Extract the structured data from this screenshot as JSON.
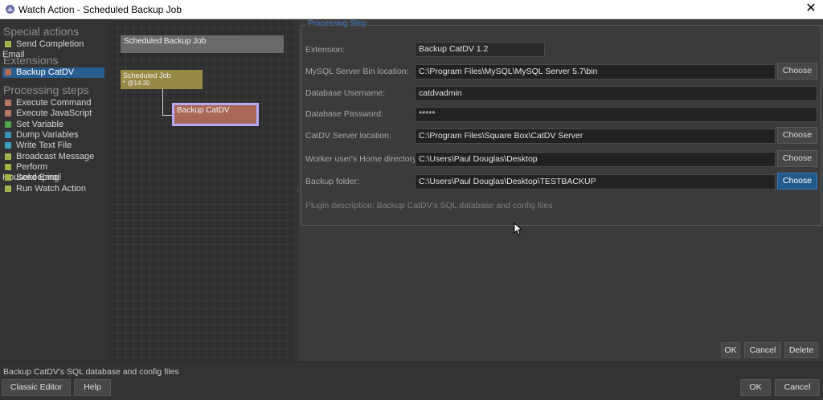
{
  "window": {
    "title": "Watch Action - Scheduled Backup Job",
    "close_glyph": "✕"
  },
  "sidebar": {
    "special_actions": {
      "heading": "Special actions",
      "items": [
        {
          "label": "Send Completion Email",
          "color": "#a6b14a"
        }
      ]
    },
    "extensions": {
      "heading": "Extensions",
      "items": [
        {
          "label": "Backup CatDV",
          "color": "#b06a55",
          "selected": true
        }
      ]
    },
    "processing_steps": {
      "heading": "Processing steps",
      "items": [
        {
          "label": "Execute Command",
          "color": "#b07a5c"
        },
        {
          "label": "Execute JavaScript",
          "color": "#b07a5c"
        },
        {
          "label": "Set Variable",
          "color": "#4fa44b"
        },
        {
          "label": "Dump Variables",
          "color": "#3f8fb6"
        },
        {
          "label": "Write Text File",
          "color": "#3fa0b8"
        },
        {
          "label": "Broadcast Message",
          "color": "#a6b14a"
        },
        {
          "label": "Perform Housekeeping",
          "color": "#a6b14a"
        },
        {
          "label": "Send Email",
          "color": "#a6b14a"
        },
        {
          "label": "Run Watch Action",
          "color": "#a6b14a"
        }
      ]
    }
  },
  "canvas": {
    "job_node": {
      "label": "Scheduled Backup Job"
    },
    "schedule_node": {
      "label": "Scheduled Job",
      "sub": "* @14:30"
    },
    "backup_node": {
      "label": "Backup CatDV"
    }
  },
  "processing_step": {
    "group_title": "Processing Step",
    "fields": [
      {
        "label": "Extension:",
        "value": "Backup CatDV 1.2"
      },
      {
        "label": "MySQL Server Bin location:",
        "value": "C:\\Program Files\\MySQL\\MySQL Server 5.7\\bin",
        "button": "Choose"
      },
      {
        "label": "Database Username:",
        "value": "catdvadmin"
      },
      {
        "label": "Database Password:",
        "value": "*****"
      },
      {
        "label": "CatDV Server location:",
        "value": "C:\\Program Files\\Square Box\\CatDV Server",
        "button": "Choose"
      },
      {
        "label": "Worker user's Home directory:",
        "value": "C:\\Users\\Paul Douglas\\Desktop",
        "button": "Choose"
      },
      {
        "label": "Backup folder:",
        "value": "C:\\Users\\Paul Douglas\\Desktop\\TESTBACKUP",
        "button": "Choose"
      }
    ],
    "description": "Plugin description: Backup CatDV's SQL database and config files"
  },
  "step_buttons": {
    "ok": "OK",
    "cancel": "Cancel",
    "delete": "Delete"
  },
  "status": {
    "text": "Backup CatDV's SQL database and config files"
  },
  "footer": {
    "classic_editor": "Classic Editor",
    "help": "Help",
    "ok": "OK",
    "cancel": "Cancel"
  },
  "colors": {
    "accent": "#2a5d8f",
    "group_title": "#3f82c4",
    "selected_outline": "#b7a9f2"
  }
}
